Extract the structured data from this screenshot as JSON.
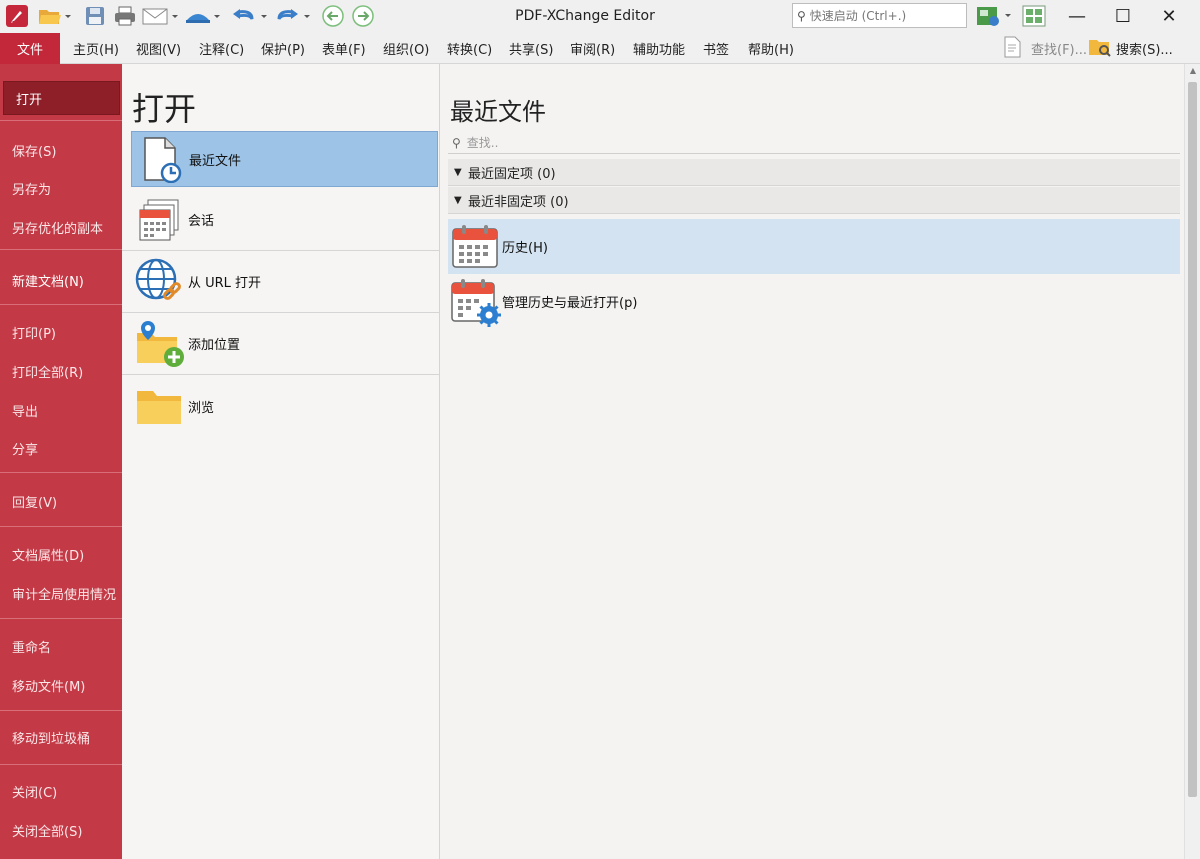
{
  "titlebar": {
    "app_title": "PDF-XChange Editor",
    "quick_search_placeholder": "快速启动 (Ctrl+.)",
    "minimize": "—",
    "maximize": "☐",
    "close": "✕"
  },
  "menubar": {
    "file": "文件",
    "items": [
      "主页(H)",
      "视图(V)",
      "注释(C)",
      "保护(P)",
      "表单(F)",
      "组织(O)",
      "转换(C)",
      "共享(S)",
      "审阅(R)",
      "辅助功能",
      "书签",
      "帮助(H)"
    ],
    "find": "查找(F)...",
    "search": "搜索(S)..."
  },
  "sidebar": {
    "items": [
      "打开",
      "保存(S)",
      "另存为",
      "另存优化的副本",
      "新建文档(N)",
      "打印(P)",
      "打印全部(R)",
      "导出",
      "分享",
      "回复(V)",
      "文档属性(D)",
      "审计全局使用情况",
      "重命名",
      "移动文件(M)",
      "移动到垃圾桶",
      "关闭(C)",
      "关闭全部(S)"
    ]
  },
  "open_panel": {
    "title": "打开",
    "items": [
      "最近文件",
      "会话",
      "从 URL 打开",
      "添加位置",
      "浏览"
    ]
  },
  "recent_panel": {
    "title": "最近文件",
    "search_placeholder": "查找..",
    "pinned_header": "最近固定项 (0)",
    "unpinned_header": "最近非固定项 (0)",
    "items": [
      "历史(H)",
      "管理历史与最近打开(p)"
    ]
  },
  "colors": {
    "accent_red": "#c3283a",
    "sidebar_red": "#c33a46",
    "selection_blue": "#9dc3e6",
    "highlight_blue": "#d3e3f1"
  }
}
